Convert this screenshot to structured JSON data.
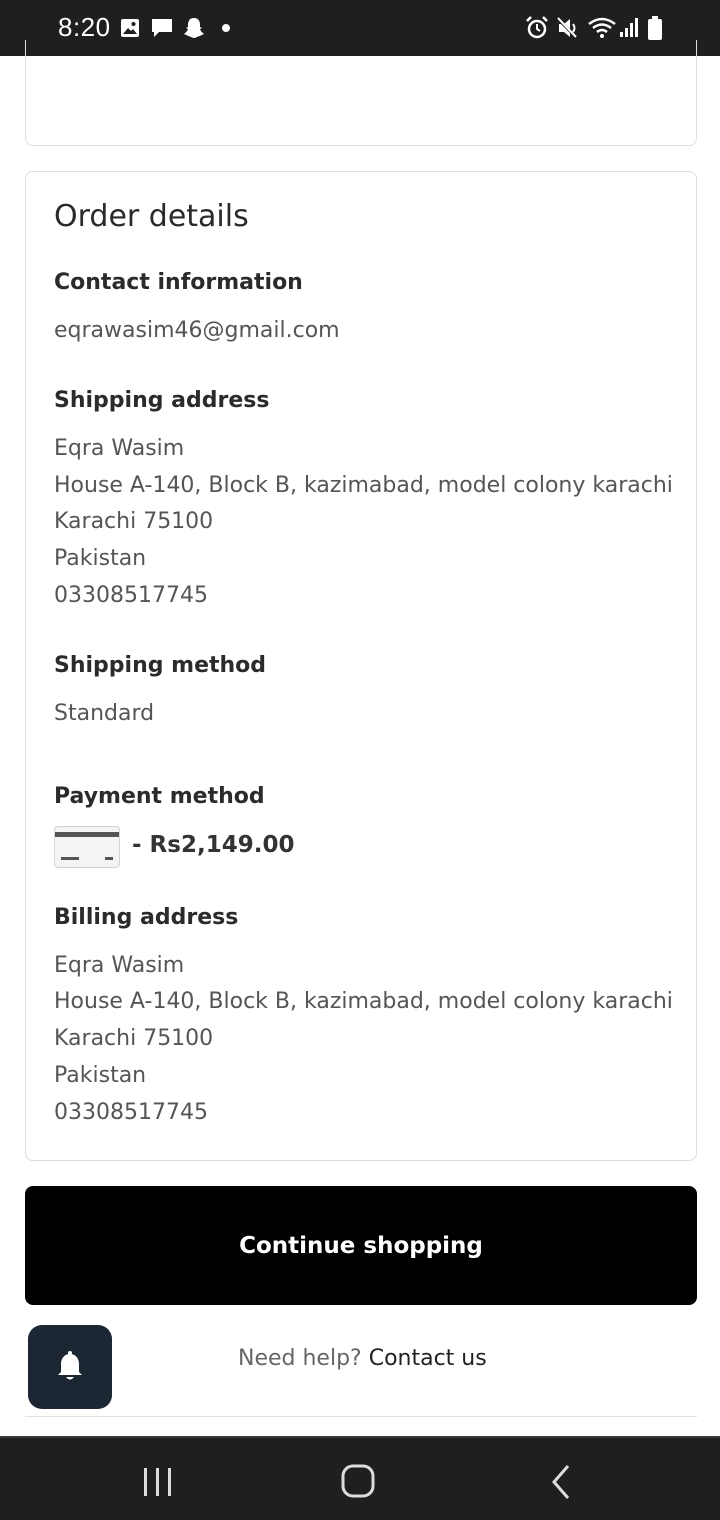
{
  "status_bar": {
    "time": "8:20",
    "left_icons": [
      "gallery-icon",
      "message-icon",
      "snapchat-icon",
      "dot-icon"
    ],
    "right_icons": [
      "alarm-icon",
      "mute-icon",
      "wifi-icon",
      "signal-icon",
      "battery-icon"
    ]
  },
  "order_details": {
    "title": "Order details",
    "contact": {
      "heading": "Contact information",
      "email": "eqrawasim46@gmail.com"
    },
    "shipping_address": {
      "heading": "Shipping address",
      "lines": [
        "Eqra Wasim",
        "House A-140, Block B, kazimabad, model colony karachi",
        "Karachi 75100",
        "Pakistan",
        "03308517745"
      ]
    },
    "shipping_method": {
      "heading": "Shipping method",
      "value": "Standard"
    },
    "payment_method": {
      "heading": "Payment method",
      "icon": "credit-card-icon",
      "amount": "- Rs2,149.00"
    },
    "billing_address": {
      "heading": "Billing address",
      "lines": [
        "Eqra Wasim",
        "House A-140, Block B, kazimabad, model colony karachi",
        "Karachi 75100",
        "Pakistan",
        "03308517745"
      ]
    }
  },
  "actions": {
    "continue_label": "Continue shopping"
  },
  "help": {
    "prefix": "Need help?",
    "link": "Contact us"
  },
  "colors": {
    "button_bg": "#000000",
    "bell_bg": "#1c2733",
    "status_bg": "#1f1f1f"
  }
}
